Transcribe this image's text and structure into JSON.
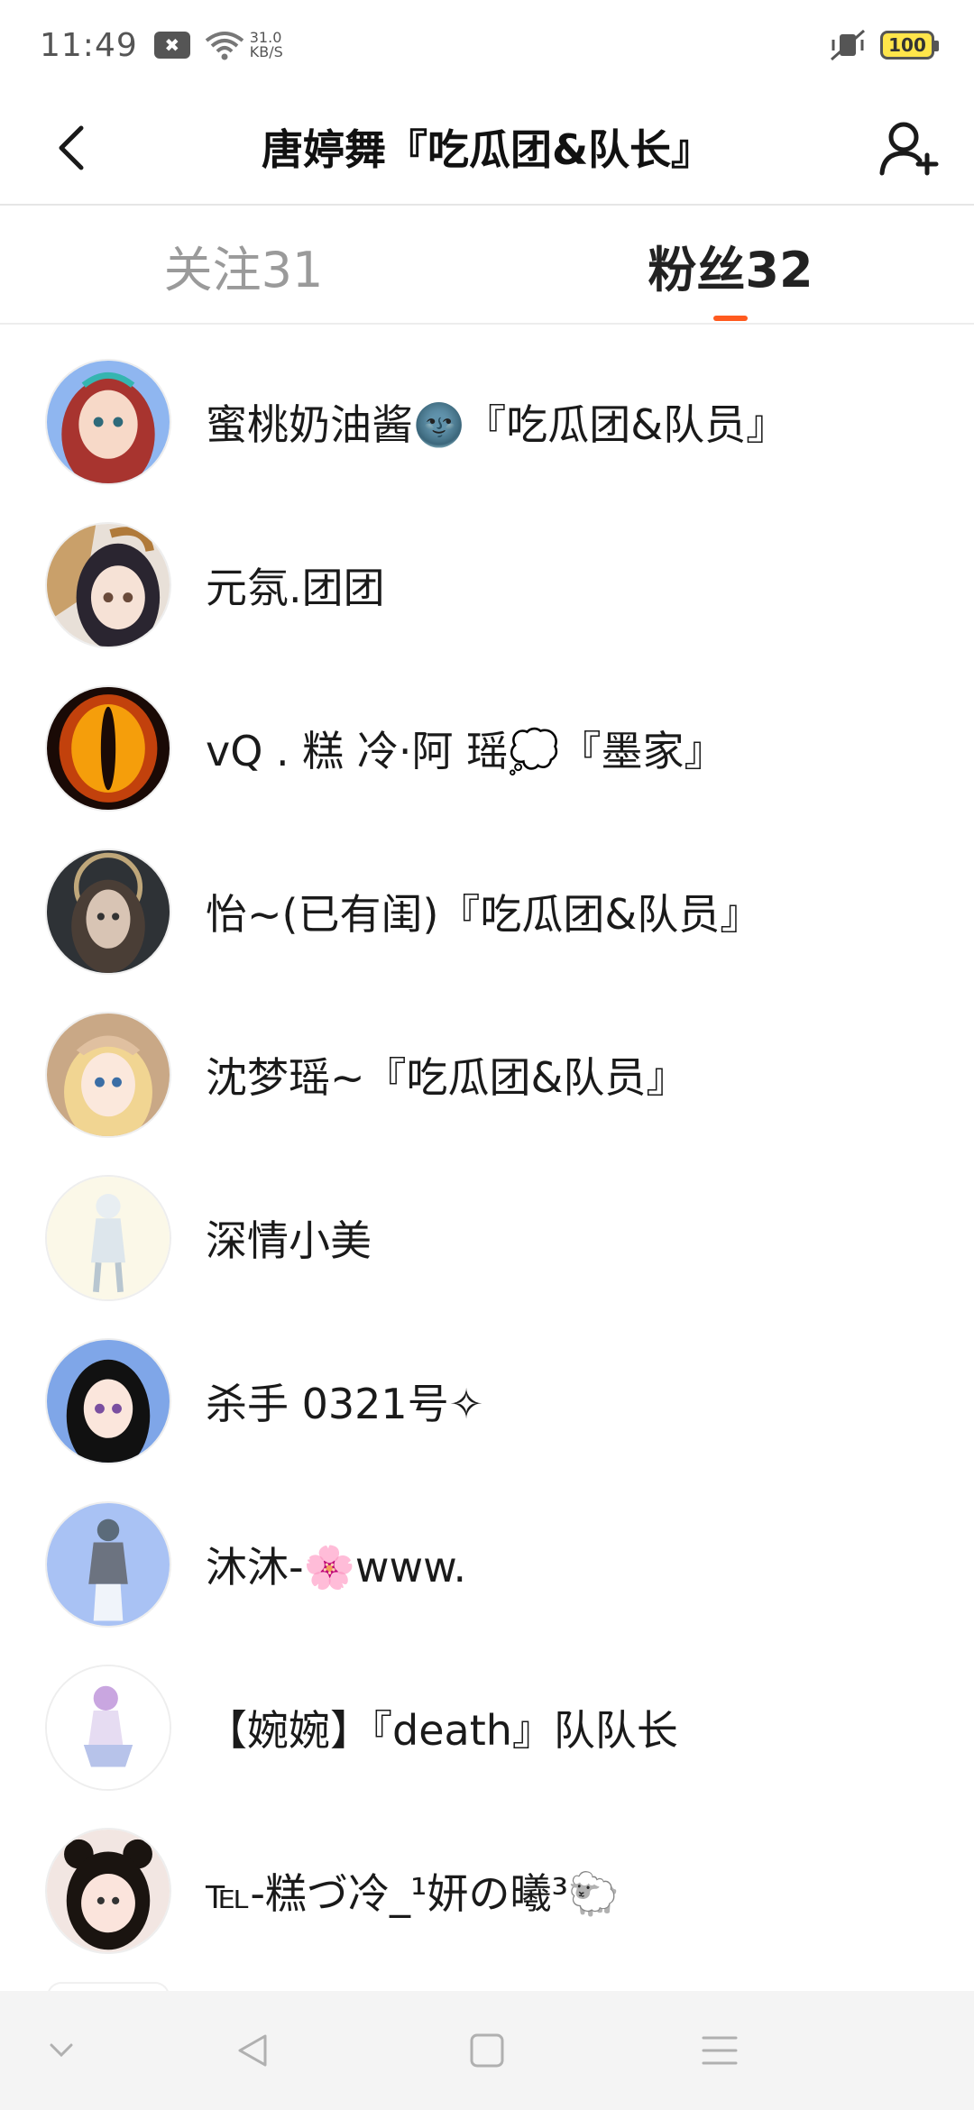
{
  "status_bar": {
    "time": "11:49",
    "x_badge": "✖",
    "net_speed_value": "31.0",
    "net_speed_unit": "KB/S",
    "battery": "100"
  },
  "header": {
    "title": "唐婷舞『吃瓜团&队长』"
  },
  "tabs": [
    {
      "label": "关注31",
      "active": false
    },
    {
      "label": "粉丝32",
      "active": true
    }
  ],
  "fans": [
    {
      "name": "蜜桃奶油酱🌚『吃瓜团&队员』",
      "avatar_icon": "anime-girl-red-hair-avatar"
    },
    {
      "name": "元氛.团团",
      "avatar_icon": "anime-girl-horns-avatar"
    },
    {
      "name": "vQ . 糕 冷·阿 瑶💭『墨家』",
      "avatar_icon": "fiery-eye-avatar"
    },
    {
      "name": "怡~(已有闺)『吃瓜团&队员』",
      "avatar_icon": "dark-goddess-avatar"
    },
    {
      "name": "沈梦瑶~『吃瓜团&队员』",
      "avatar_icon": "anime-girl-blonde-avatar"
    },
    {
      "name": "深情小美",
      "avatar_icon": "white-figure-avatar"
    },
    {
      "name": "杀手 0321号✧",
      "avatar_icon": "anime-girl-black-hair-avatar"
    },
    {
      "name": "沐沐-🌸www.",
      "avatar_icon": "blue-figure-avatar"
    },
    {
      "name": "【婉婉】『death』队队长",
      "avatar_icon": "purple-hair-figure-avatar"
    },
    {
      "name": "℡-糕づ冷_¹妍の曦³🐑",
      "avatar_icon": "anime-girl-buns-avatar"
    }
  ],
  "colors": {
    "accent": "#ff5a1f",
    "tab_inactive": "#9a9a9a",
    "navbar_bg": "#f4f4f4"
  }
}
